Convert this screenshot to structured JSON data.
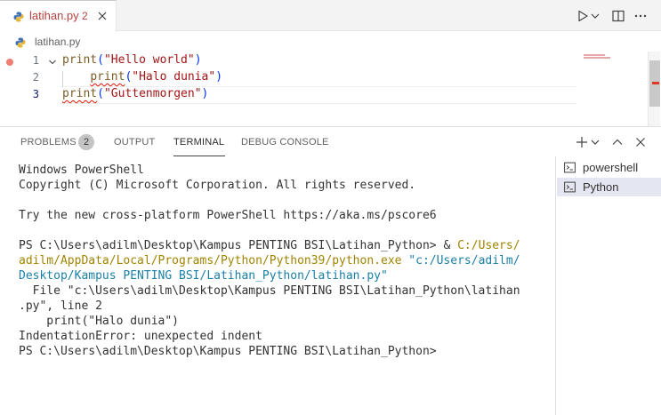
{
  "tab": {
    "filename": "latihan.py",
    "problem_count": "2",
    "icon": "python-file-icon",
    "close_icon": "close-icon"
  },
  "title_actions": {
    "run_icon": "run-icon",
    "run_menu_icon": "chevron-down-icon",
    "split_icon": "split-editor-icon",
    "more_icon": "more-icon"
  },
  "breadcrumb": {
    "file": "latihan.py"
  },
  "editor": {
    "lines": [
      {
        "number": "1",
        "fn": "print",
        "open": "(",
        "string": "\"Hello world\"",
        "close": ")"
      },
      {
        "number": "2",
        "indent": "    ",
        "fn": "print",
        "open": "(",
        "string": "\"Halo dunia\"",
        "close": ")"
      },
      {
        "number": "3",
        "fn": "print",
        "open": "(",
        "string": "\"Guttenmorgen\"",
        "close": ")"
      }
    ]
  },
  "panel": {
    "tabs": {
      "problems": "PROBLEMS",
      "output": "OUTPUT",
      "terminal": "TERMINAL",
      "debug_console": "DEBUG CONSOLE"
    },
    "problems_badge": "2",
    "active_tab": "TERMINAL",
    "actions": {
      "new_terminal_icon": "plus-icon",
      "new_terminal_menu_icon": "chevron-down-icon",
      "maximize_icon": "chevron-up-icon",
      "close_icon": "close-icon"
    }
  },
  "terminal": {
    "header1": "Windows PowerShell",
    "header2": "Copyright (C) Microsoft Corporation. All rights reserved.",
    "tip": "Try the new cross-platform PowerShell https://aka.ms/pscore6",
    "prompt1": "PS C:\\Users\\adilm\\Desktop\\Kampus PENTING BSI\\Latihan_Python> ",
    "cmd_amp": "& ",
    "exe_part1": "C:/Users/",
    "exe_part2": "adilm/AppData/Local/Programs/Python/Python39/python.exe",
    "arg_part1": "\"c:/Users/adilm/",
    "arg_part2": "Desktop/Kampus PENTING BSI/Latihan_Python/latihan.py\"",
    "trace1": "  File \"c:\\Users\\adilm\\Desktop\\Kampus PENTING BSI\\Latihan_Python\\latihan",
    "trace2": ".py\", line 2",
    "trace3": "    print(\"Halo dunia\")",
    "error": "IndentationError: unexpected indent",
    "prompt2": "PS C:\\Users\\adilm\\Desktop\\Kampus PENTING BSI\\Latihan_Python>"
  },
  "terminal_list": {
    "items": [
      {
        "label": "powershell",
        "icon": "terminal-icon",
        "selected": false
      },
      {
        "label": "Python",
        "icon": "terminal-icon",
        "selected": true
      }
    ]
  },
  "colors": {
    "error": "#e51400",
    "string": "#a31515",
    "function": "#795e26",
    "path_yellow": "#a18400",
    "path_cyan": "#1a7fa6"
  }
}
